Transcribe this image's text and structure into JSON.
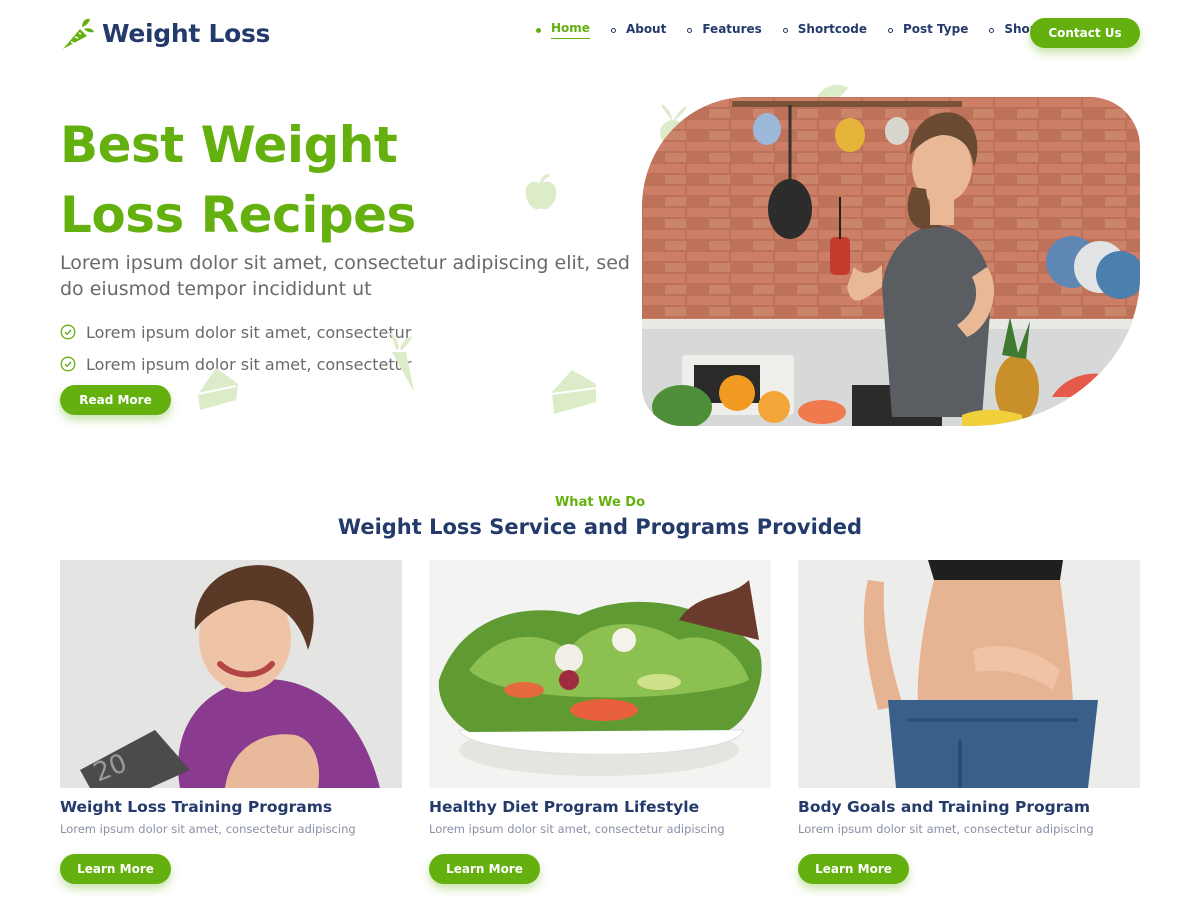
{
  "brand": {
    "name": "Weight Loss",
    "logo_icon": "carrot-icon",
    "accent": "#64b00f",
    "navy": "#233a6b"
  },
  "nav": {
    "items": [
      {
        "label": "Home",
        "active": true
      },
      {
        "label": "About"
      },
      {
        "label": "Features"
      },
      {
        "label": "Shortcode"
      },
      {
        "label": "Post Type"
      },
      {
        "label": "Shop"
      }
    ],
    "contact_label": "Contact Us"
  },
  "hero": {
    "title_line1": "Best Weight",
    "title_line2": "Loss Recipes",
    "subtitle": "Lorem ipsum dolor sit amet, consectetur adipiscing elit, sed do eiusmod tempor incididunt ut",
    "checks": [
      "Lorem ipsum dolor sit amet, consectetur",
      "Lorem ipsum dolor sit amet, consectetur"
    ],
    "button_label": "Read More",
    "decorations": [
      "apple-icon",
      "radish-icon",
      "carrot-icon",
      "cake-slice-icon"
    ]
  },
  "services": {
    "kicker": "What We Do",
    "title": "Weight Loss Service and Programs Provided",
    "cards": [
      {
        "title": "Weight Loss Training Programs",
        "text": "Lorem ipsum dolor sit amet, consectetur adipiscing",
        "button": "Learn More"
      },
      {
        "title": "Healthy Diet Program Lifestyle",
        "text": "Lorem ipsum dolor sit amet, consectetur adipiscing",
        "button": "Learn More"
      },
      {
        "title": "Body Goals and Training Program",
        "text": "Lorem ipsum dolor sit amet, consectetur adipiscing",
        "button": "Learn More"
      }
    ]
  }
}
